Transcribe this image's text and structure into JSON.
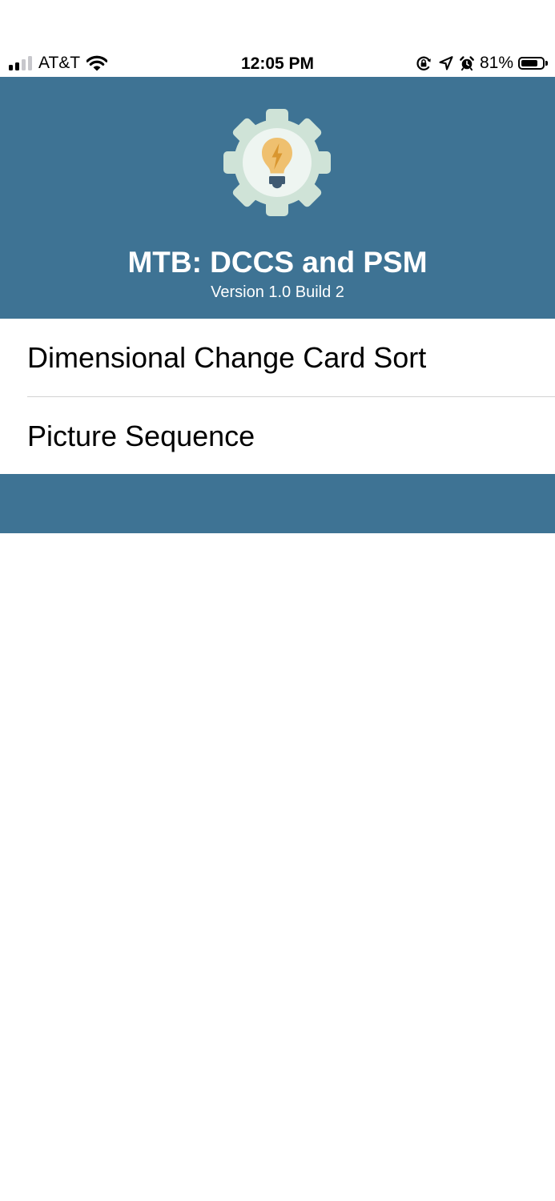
{
  "status_bar": {
    "carrier": "AT&T",
    "time": "12:05 PM",
    "battery_percent": "81%",
    "battery_level": 0.81,
    "signal_bars_active": 2,
    "signal_bars_total": 4,
    "icons": [
      "signal-icon",
      "wifi-icon",
      "orientation-lock-icon",
      "location-arrow-icon",
      "alarm-icon",
      "battery-icon"
    ]
  },
  "header": {
    "logo_icon": "gear-lightbulb-icon",
    "title": "MTB: DCCS and PSM",
    "version": "Version 1.0 Build 2"
  },
  "menu": {
    "items": [
      {
        "label": "Dimensional Change Card Sort"
      },
      {
        "label": "Picture Sequence"
      }
    ]
  },
  "colors": {
    "header_background": "#3e7394",
    "gear_color": "#cfe3d7",
    "gear_inner_color": "#eef5f1",
    "bulb_color": "#efc06f",
    "bolt_color": "#d9962f",
    "bulb_base_color": "#3f5a72",
    "divider_color": "#d2d2d2"
  }
}
